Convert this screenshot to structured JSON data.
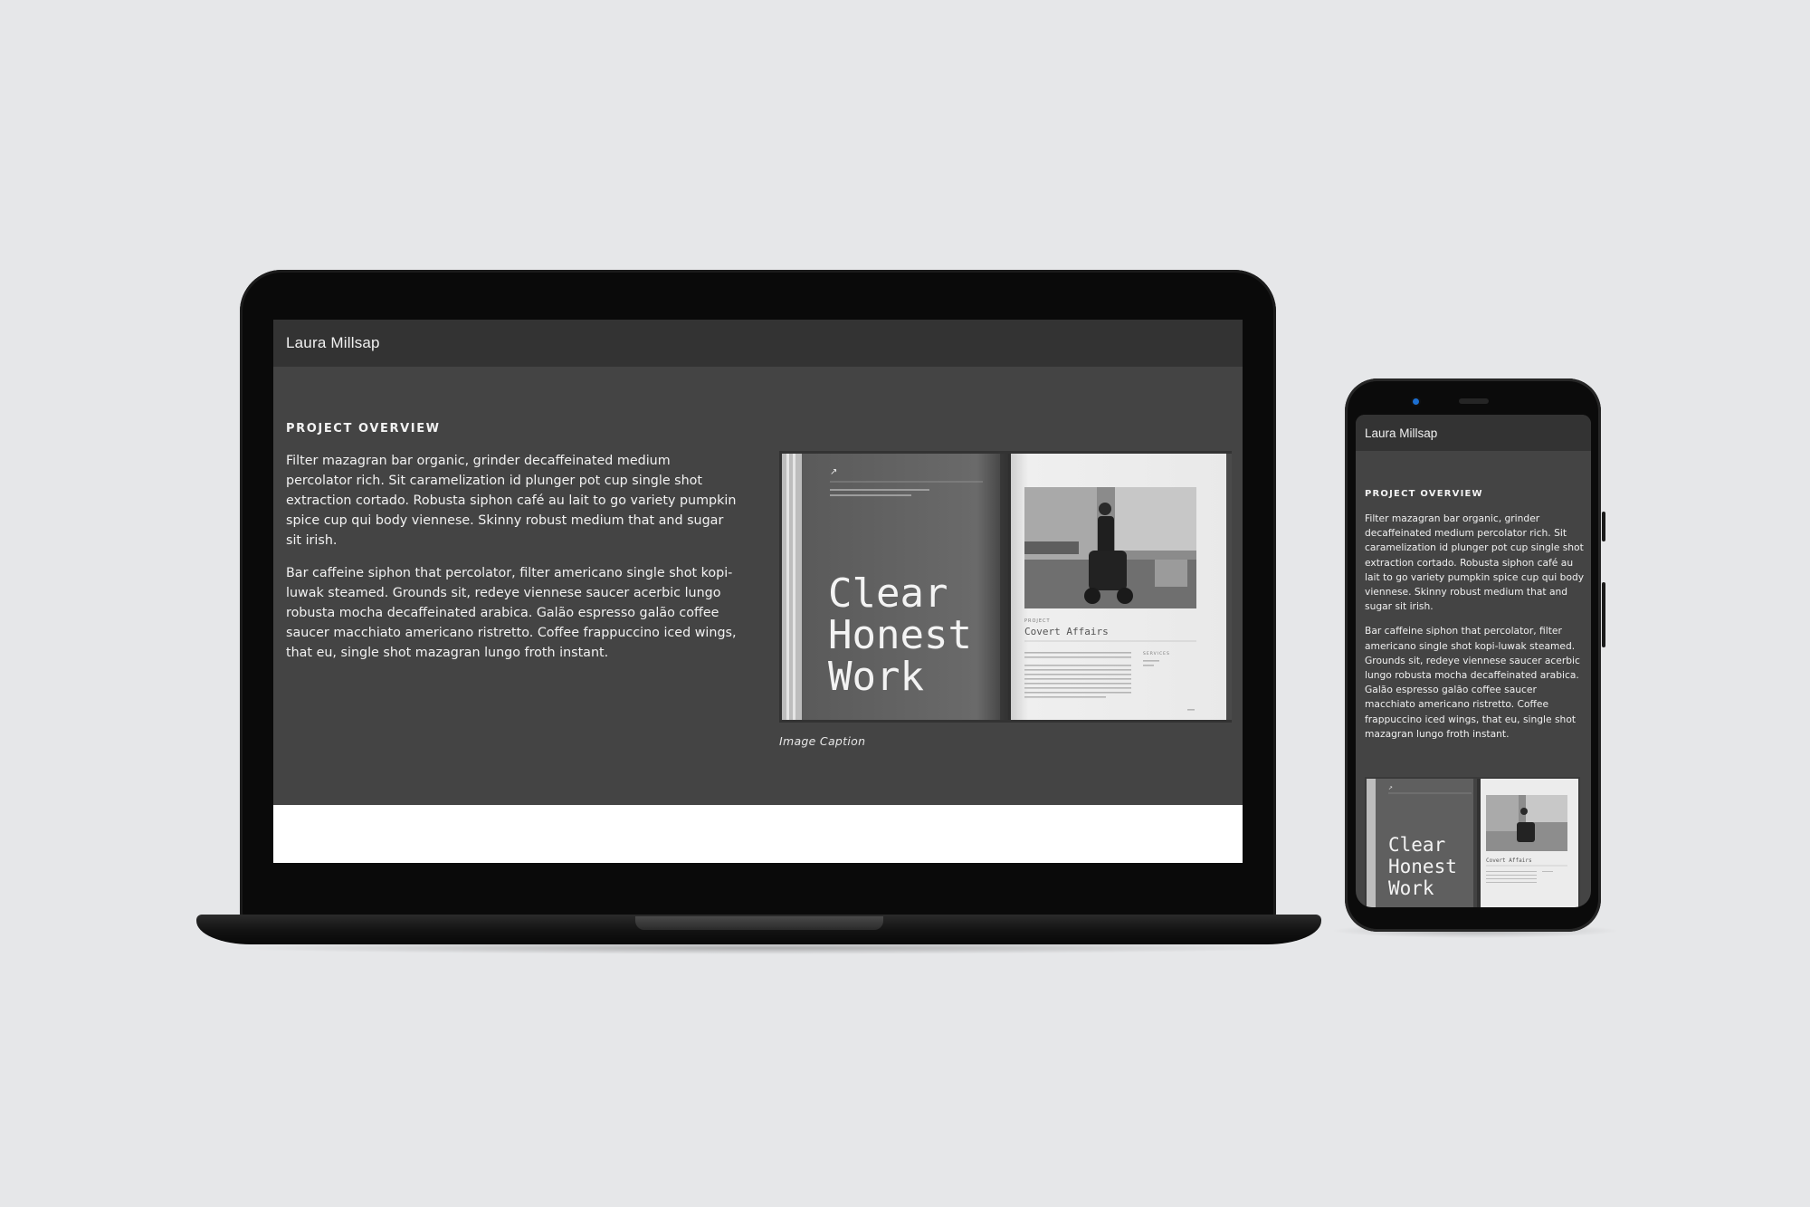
{
  "site": {
    "name": "Laura Millsap"
  },
  "project": {
    "section_title": "PROJECT OVERVIEW",
    "paragraphs": [
      "Filter mazagran bar organic, grinder decaffeinated medium percolator rich. Sit caramelization id plunger pot cup single shot extraction cortado. Robusta siphon café au lait to go variety pumpkin spice cup qui body viennese. Skinny robust medium that and sugar sit irish.",
      "Bar caffeine siphon that percolator, filter americano single shot kopi-luwak steamed. Grounds sit, redeye viennese saucer acerbic lungo robusta mocha decaffeinated arabica. Galão espresso galão coffee saucer macchiato americano ristretto. Coffee frappuccino iced wings, that eu, single shot mazagran lungo froth instant."
    ],
    "image_caption": "Image Caption"
  },
  "book": {
    "cover_lines": [
      "Clear",
      "Honest",
      "Work"
    ],
    "project_label": "PROJECT",
    "project_name": "Covert Affairs",
    "services_label": "SERVICES"
  },
  "colors": {
    "page_background": "#e6e7e9",
    "device_frame": "#0a0a0a",
    "screen_background": "#444444",
    "header_background": "#333333",
    "text": "#f2f2f2",
    "footer": "#ffffff",
    "camera_accent": "#1c6fd1"
  }
}
